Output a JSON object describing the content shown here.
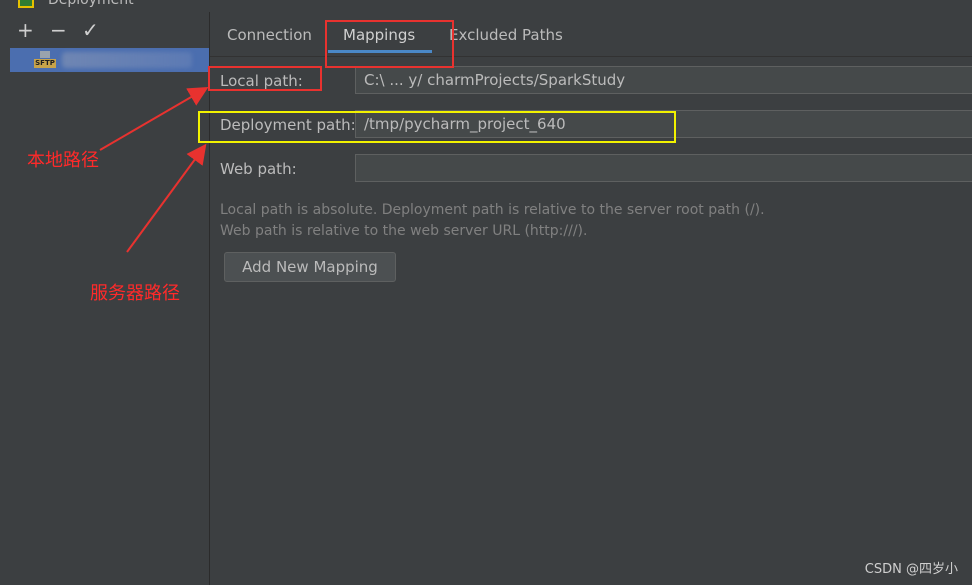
{
  "window": {
    "title": "Deployment"
  },
  "sidebar": {
    "add": "+",
    "remove": "−",
    "apply": "✓",
    "server_icon_label": "SFTP"
  },
  "tabs": [
    {
      "label": "Connection"
    },
    {
      "label": "Mappings"
    },
    {
      "label": "Excluded Paths"
    }
  ],
  "mapping": {
    "local_label": "Local path:",
    "local_value": "C:\\ ...   y/  charmProjects/SparkStudy",
    "deploy_label": "Deployment path:",
    "deploy_value": "/tmp/pycharm_project_640",
    "web_label": "Web path:",
    "web_value": ""
  },
  "hints": {
    "line1": "Local path is absolute. Deployment path is relative to the server root path (/).",
    "line2": "Web path is relative to the web server URL (http:///)."
  },
  "buttons": {
    "add_mapping": "Add New Mapping"
  },
  "annotations": {
    "local_note": "本地路径",
    "server_note": "服务器路径",
    "red": "#e8322f",
    "yellow": "#f2f200"
  },
  "watermark": "CSDN @四岁小"
}
